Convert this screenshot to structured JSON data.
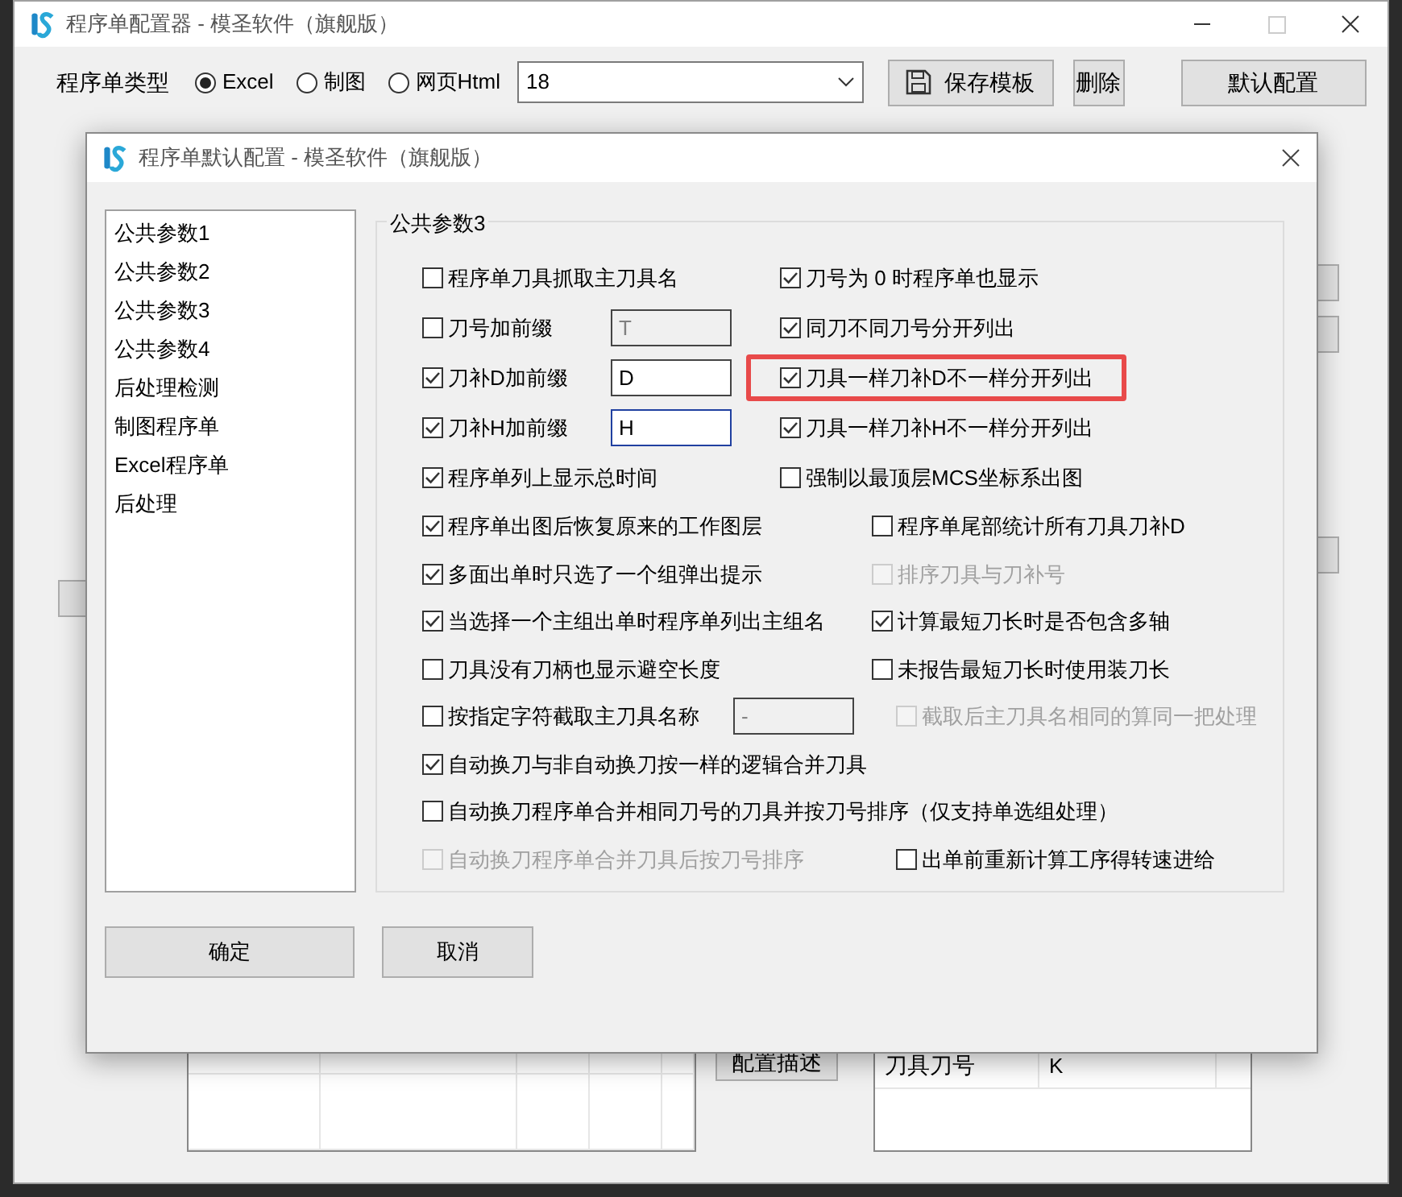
{
  "main_window": {
    "title": "程序单配置器 - 模圣软件（旗舰版）",
    "type_label": "程序单类型",
    "radios": [
      {
        "label": "Excel",
        "selected": true
      },
      {
        "label": "制图",
        "selected": false
      },
      {
        "label": "网页Html",
        "selected": false
      }
    ],
    "template_dropdown": {
      "value": "18"
    },
    "buttons": [
      {
        "label": "保存模板",
        "kind": "save"
      },
      {
        "label": "删除",
        "kind": "plain"
      },
      {
        "label": "默认配置",
        "kind": "wide"
      }
    ],
    "describe_button": "配置描述",
    "right_table": {
      "rows": [
        [
          "刀具刀号",
          "K"
        ]
      ]
    }
  },
  "dialog": {
    "title": "程序单默认配置 - 模圣软件（旗舰版）",
    "nav_items": [
      {
        "label": "公共参数1",
        "selected": false
      },
      {
        "label": "公共参数2",
        "selected": false
      },
      {
        "label": "公共参数3",
        "selected": false
      },
      {
        "label": "公共参数4",
        "selected": false
      },
      {
        "label": "后处理检测",
        "selected": false
      },
      {
        "label": "制图程序单",
        "selected": false
      },
      {
        "label": "Excel程序单",
        "selected": false
      },
      {
        "label": "后处理",
        "selected": false
      }
    ],
    "group_title": "公共参数3",
    "rows_top": [
      {
        "left": {
          "label": "程序单刀具抓取主刀具名",
          "checked": false,
          "disabled": false
        },
        "right": {
          "label": "刀号为 0 时程序单也显示",
          "checked": true,
          "disabled": false
        }
      },
      {
        "left": {
          "label": "刀号加前缀",
          "checked": false,
          "disabled": false
        },
        "field": {
          "value": "T",
          "disabled": true,
          "focused": false
        },
        "right": {
          "label": "同刀不同刀号分开列出",
          "checked": true,
          "disabled": false
        }
      },
      {
        "left": {
          "label": "刀补D加前缀",
          "checked": true,
          "disabled": false
        },
        "field": {
          "value": "D",
          "disabled": false,
          "focused": false
        },
        "right": {
          "label": "刀具一样刀补D不一样分开列出",
          "checked": true,
          "disabled": false,
          "highlighted": true
        }
      },
      {
        "left": {
          "label": "刀补H加前缀",
          "checked": true,
          "disabled": false
        },
        "field": {
          "value": "H",
          "disabled": false,
          "focused": true
        },
        "right": {
          "label": "刀具一样刀补H不一样分开列出",
          "checked": true,
          "disabled": false
        }
      },
      {
        "left": {
          "label": "程序单列上显示总时间",
          "checked": true,
          "disabled": false
        },
        "right": {
          "label": "强制以最顶层MCS坐标系出图",
          "checked": false,
          "disabled": false
        }
      }
    ],
    "rows_bottom": [
      {
        "left": {
          "label": "程序单出图后恢复原来的工作图层",
          "checked": true,
          "disabled": false
        },
        "right": {
          "label": "程序单尾部统计所有刀具刀补D",
          "checked": false,
          "disabled": false
        }
      },
      {
        "left": {
          "label": "多面出单时只选了一个组弹出提示",
          "checked": true,
          "disabled": false
        },
        "right": {
          "label": "排序刀具与刀补号",
          "checked": false,
          "disabled": true
        }
      },
      {
        "left": {
          "label": "当选择一个主组出单时程序单列出主组名",
          "checked": true,
          "disabled": false
        },
        "right": {
          "label": "计算最短刀长时是否包含多轴",
          "checked": true,
          "disabled": false
        }
      },
      {
        "left": {
          "label": "刀具没有刀柄也显示避空长度",
          "checked": false,
          "disabled": false
        },
        "right": {
          "label": "未报告最短刀长时使用装刀长",
          "checked": false,
          "disabled": false
        }
      },
      {
        "left": {
          "label": "按指定字符截取主刀具名称",
          "checked": false,
          "disabled": false
        },
        "field": {
          "value": "-",
          "disabled": true,
          "focused": false
        },
        "right": {
          "label": "截取后主刀具名相同的算同一把处理",
          "checked": false,
          "disabled": true
        }
      },
      {
        "left": {
          "label": "自动换刀与非自动换刀按一样的逻辑合并刀具",
          "checked": true,
          "disabled": false
        }
      },
      {
        "left": {
          "label": "自动换刀程序单合并相同刀号的刀具并按刀号排序（仅支持单选组处理）",
          "checked": false,
          "disabled": false
        }
      },
      {
        "left": {
          "label": "自动换刀程序单合并刀具后按刀号排序",
          "checked": false,
          "disabled": true
        },
        "right": {
          "label": "出单前重新计算工序得转速进给",
          "checked": false,
          "disabled": false
        }
      }
    ],
    "buttons": [
      {
        "label": "确定",
        "kind": "wide"
      },
      {
        "label": "取消",
        "kind": "plain"
      }
    ]
  }
}
